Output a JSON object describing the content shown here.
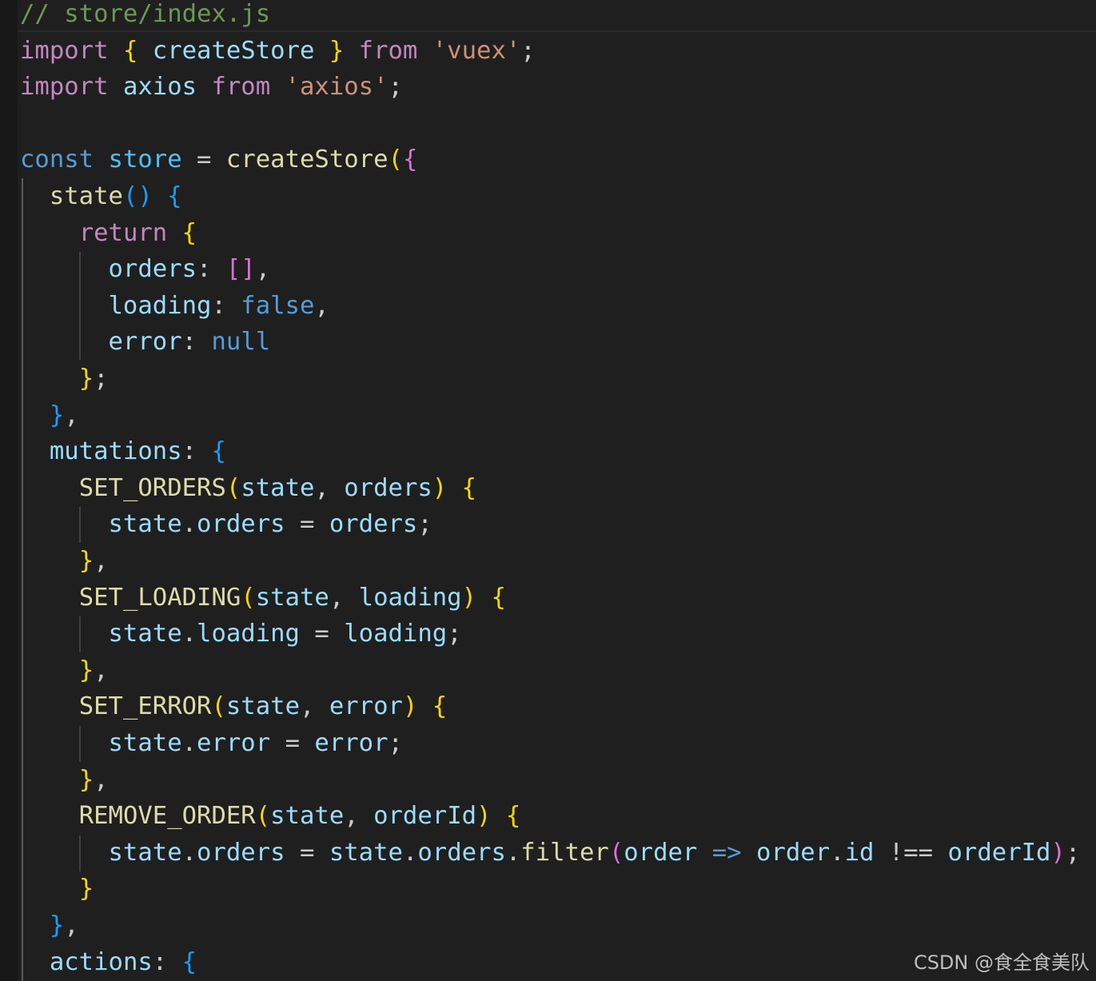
{
  "editor": {
    "file_comment": "// store/index.js",
    "colors": {
      "background": "#1f1f1f",
      "comment": "#6a9955",
      "keyword": "#c586c0",
      "string": "#ce9178",
      "function": "#dcdcaa",
      "variable": "#9cdcfe",
      "literal": "#569cd6",
      "bracket_1": "#ffd700",
      "bracket_2": "#da70d6",
      "bracket_3": "#179fff"
    },
    "lines": [
      [
        [
          "cm",
          "// store/index.js"
        ]
      ],
      [
        [
          "kw",
          "import"
        ],
        [
          "pn",
          " "
        ],
        [
          "b1",
          "{"
        ],
        [
          "pn",
          " "
        ],
        [
          "vr",
          "createStore"
        ],
        [
          "pn",
          " "
        ],
        [
          "b1",
          "}"
        ],
        [
          "pn",
          " "
        ],
        [
          "kw",
          "from"
        ],
        [
          "pn",
          " "
        ],
        [
          "st",
          "'vuex'"
        ],
        [
          "pn",
          ";"
        ]
      ],
      [
        [
          "kw",
          "import"
        ],
        [
          "pn",
          " "
        ],
        [
          "vr",
          "axios"
        ],
        [
          "pn",
          " "
        ],
        [
          "kw",
          "from"
        ],
        [
          "pn",
          " "
        ],
        [
          "st",
          "'axios'"
        ],
        [
          "pn",
          ";"
        ]
      ],
      [],
      [
        [
          "bl",
          "const"
        ],
        [
          "pn",
          " "
        ],
        [
          "cn",
          "store"
        ],
        [
          "pn",
          " = "
        ],
        [
          "fn",
          "createStore"
        ],
        [
          "b1",
          "("
        ],
        [
          "b2",
          "{"
        ]
      ],
      [
        [
          "pn",
          "  "
        ],
        [
          "fn",
          "state"
        ],
        [
          "b3",
          "()"
        ],
        [
          "pn",
          " "
        ],
        [
          "b3",
          "{"
        ]
      ],
      [
        [
          "pn",
          "    "
        ],
        [
          "kw",
          "return"
        ],
        [
          "pn",
          " "
        ],
        [
          "b1",
          "{"
        ]
      ],
      [
        [
          "pn",
          "      "
        ],
        [
          "vr",
          "orders"
        ],
        [
          "pn",
          ": "
        ],
        [
          "b2",
          "[]"
        ],
        [
          "pn",
          ","
        ]
      ],
      [
        [
          "pn",
          "      "
        ],
        [
          "vr",
          "loading"
        ],
        [
          "pn",
          ": "
        ],
        [
          "bl",
          "false"
        ],
        [
          "pn",
          ","
        ]
      ],
      [
        [
          "pn",
          "      "
        ],
        [
          "vr",
          "error"
        ],
        [
          "pn",
          ": "
        ],
        [
          "bl",
          "null"
        ]
      ],
      [
        [
          "pn",
          "    "
        ],
        [
          "b1",
          "}"
        ],
        [
          "pn",
          ";"
        ]
      ],
      [
        [
          "pn",
          "  "
        ],
        [
          "b3",
          "}"
        ],
        [
          "pn",
          ","
        ]
      ],
      [
        [
          "pn",
          "  "
        ],
        [
          "vr",
          "mutations"
        ],
        [
          "pn",
          ": "
        ],
        [
          "b3",
          "{"
        ]
      ],
      [
        [
          "pn",
          "    "
        ],
        [
          "fn",
          "SET_ORDERS"
        ],
        [
          "b1",
          "("
        ],
        [
          "vr",
          "state"
        ],
        [
          "pn",
          ", "
        ],
        [
          "vr",
          "orders"
        ],
        [
          "b1",
          ")"
        ],
        [
          "pn",
          " "
        ],
        [
          "b1",
          "{"
        ]
      ],
      [
        [
          "pn",
          "      "
        ],
        [
          "vr",
          "state"
        ],
        [
          "pn",
          "."
        ],
        [
          "vr",
          "orders"
        ],
        [
          "pn",
          " = "
        ],
        [
          "vr",
          "orders"
        ],
        [
          "pn",
          ";"
        ]
      ],
      [
        [
          "pn",
          "    "
        ],
        [
          "b1",
          "}"
        ],
        [
          "pn",
          ","
        ]
      ],
      [
        [
          "pn",
          "    "
        ],
        [
          "fn",
          "SET_LOADING"
        ],
        [
          "b1",
          "("
        ],
        [
          "vr",
          "state"
        ],
        [
          "pn",
          ", "
        ],
        [
          "vr",
          "loading"
        ],
        [
          "b1",
          ")"
        ],
        [
          "pn",
          " "
        ],
        [
          "b1",
          "{"
        ]
      ],
      [
        [
          "pn",
          "      "
        ],
        [
          "vr",
          "state"
        ],
        [
          "pn",
          "."
        ],
        [
          "vr",
          "loading"
        ],
        [
          "pn",
          " = "
        ],
        [
          "vr",
          "loading"
        ],
        [
          "pn",
          ";"
        ]
      ],
      [
        [
          "pn",
          "    "
        ],
        [
          "b1",
          "}"
        ],
        [
          "pn",
          ","
        ]
      ],
      [
        [
          "pn",
          "    "
        ],
        [
          "fn",
          "SET_ERROR"
        ],
        [
          "b1",
          "("
        ],
        [
          "vr",
          "state"
        ],
        [
          "pn",
          ", "
        ],
        [
          "vr",
          "error"
        ],
        [
          "b1",
          ")"
        ],
        [
          "pn",
          " "
        ],
        [
          "b1",
          "{"
        ]
      ],
      [
        [
          "pn",
          "      "
        ],
        [
          "vr",
          "state"
        ],
        [
          "pn",
          "."
        ],
        [
          "vr",
          "error"
        ],
        [
          "pn",
          " = "
        ],
        [
          "vr",
          "error"
        ],
        [
          "pn",
          ";"
        ]
      ],
      [
        [
          "pn",
          "    "
        ],
        [
          "b1",
          "}"
        ],
        [
          "pn",
          ","
        ]
      ],
      [
        [
          "pn",
          "    "
        ],
        [
          "fn",
          "REMOVE_ORDER"
        ],
        [
          "b1",
          "("
        ],
        [
          "vr",
          "state"
        ],
        [
          "pn",
          ", "
        ],
        [
          "vr",
          "orderId"
        ],
        [
          "b1",
          ")"
        ],
        [
          "pn",
          " "
        ],
        [
          "b1",
          "{"
        ]
      ],
      [
        [
          "pn",
          "      "
        ],
        [
          "vr",
          "state"
        ],
        [
          "pn",
          "."
        ],
        [
          "vr",
          "orders"
        ],
        [
          "pn",
          " = "
        ],
        [
          "vr",
          "state"
        ],
        [
          "pn",
          "."
        ],
        [
          "vr",
          "orders"
        ],
        [
          "pn",
          "."
        ],
        [
          "fn",
          "filter"
        ],
        [
          "b2",
          "("
        ],
        [
          "vr",
          "order"
        ],
        [
          "pn",
          " "
        ],
        [
          "bl",
          "=>"
        ],
        [
          "pn",
          " "
        ],
        [
          "vr",
          "order"
        ],
        [
          "pn",
          "."
        ],
        [
          "vr",
          "id"
        ],
        [
          "pn",
          " !== "
        ],
        [
          "vr",
          "orderId"
        ],
        [
          "b2",
          ")"
        ],
        [
          "pn",
          ";"
        ]
      ],
      [
        [
          "pn",
          "    "
        ],
        [
          "b1",
          "}"
        ]
      ],
      [
        [
          "pn",
          "  "
        ],
        [
          "b3",
          "}"
        ],
        [
          "pn",
          ","
        ]
      ],
      [
        [
          "pn",
          "  "
        ],
        [
          "vr",
          "actions"
        ],
        [
          "pn",
          ": "
        ],
        [
          "b3",
          "{"
        ]
      ]
    ]
  },
  "watermark": "CSDN @食全食美队"
}
